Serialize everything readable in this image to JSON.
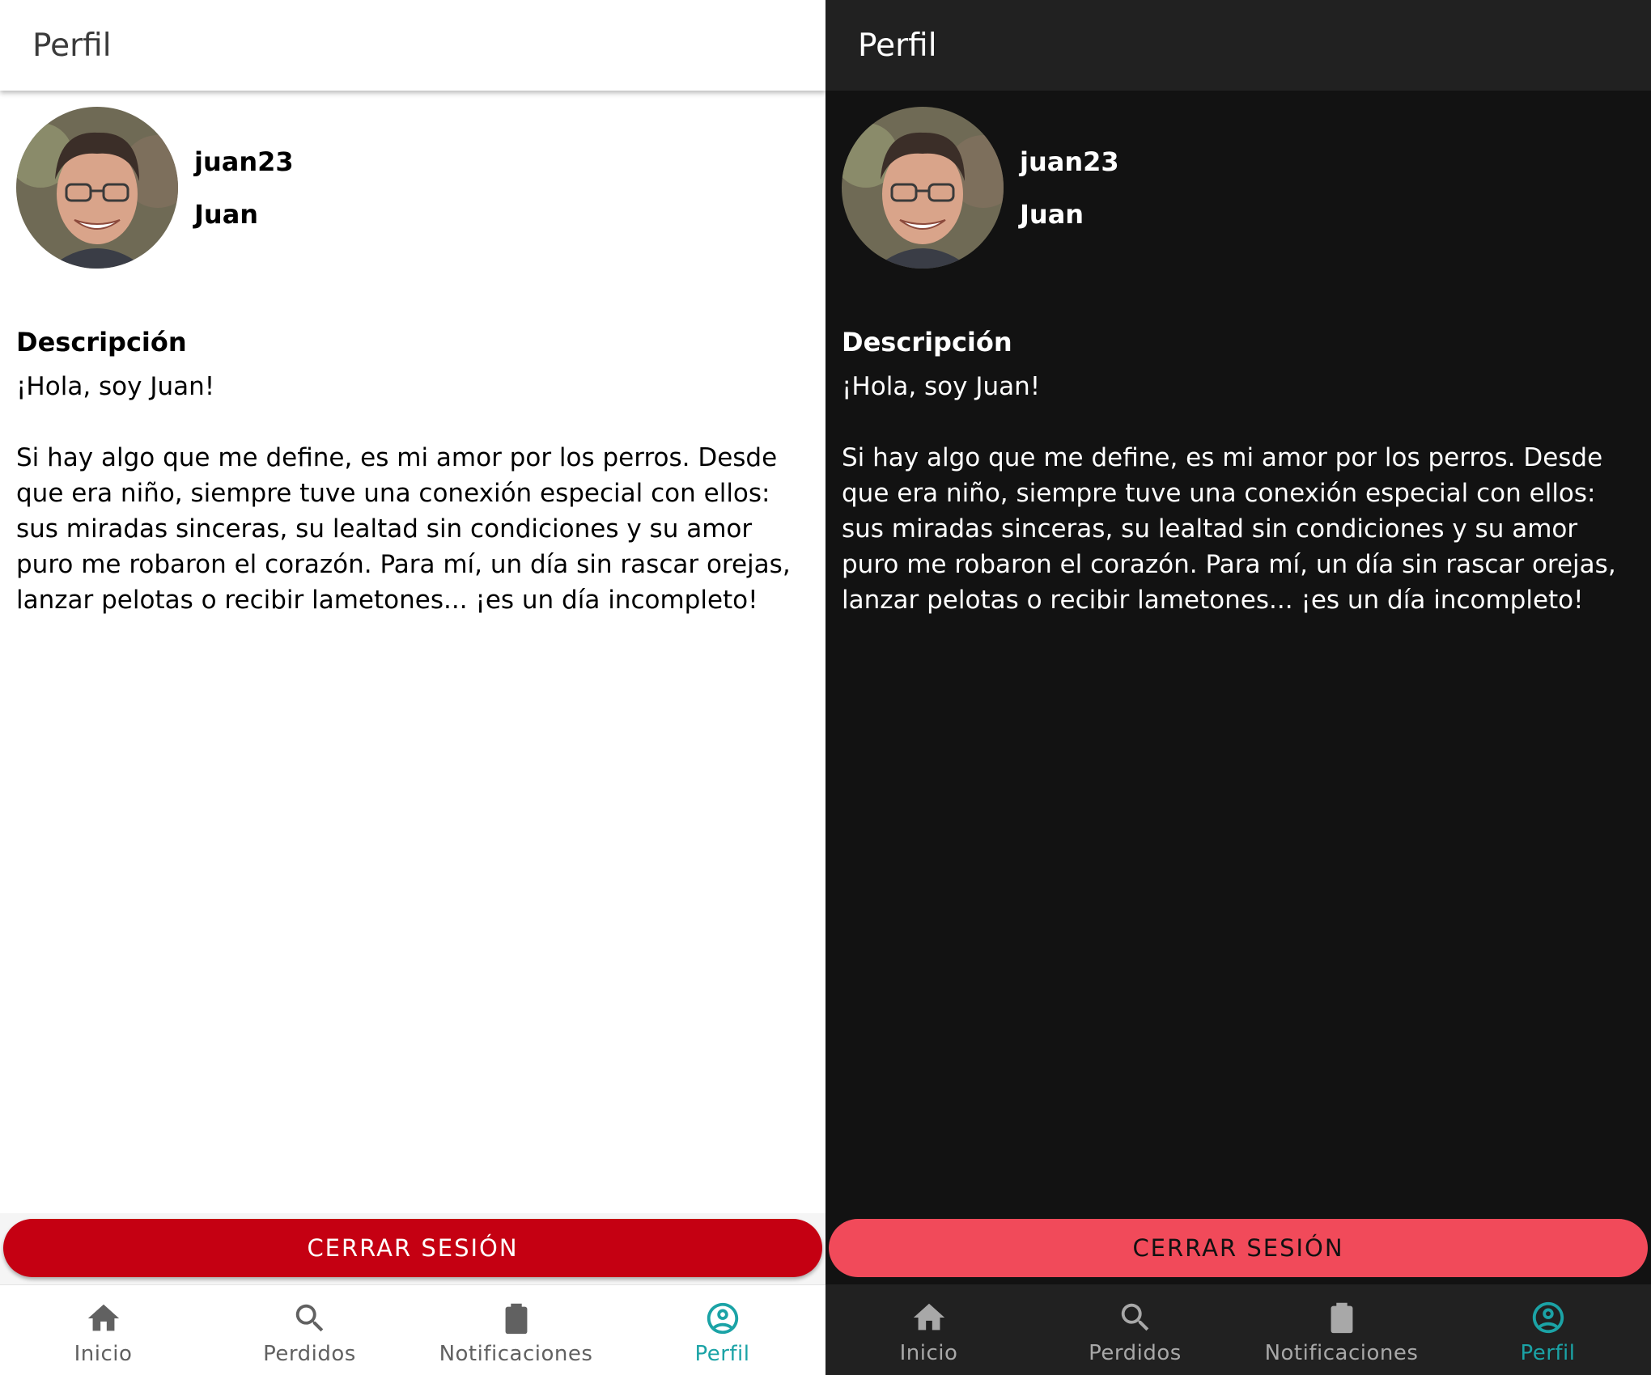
{
  "light": {
    "header": {
      "title": "Perfil"
    },
    "profile": {
      "username": "juan23",
      "name": "Juan"
    },
    "description": {
      "heading": "Descripción",
      "greeting": "¡Hola, soy Juan!",
      "body": "Si hay algo que me define, es mi amor por los perros. Desde que era niño, siempre tuve una conexión especial con ellos: sus miradas sinceras, su lealtad sin condiciones y su amor puro me robaron el corazón. Para mí, un día sin rascar orejas, lanzar pelotas o recibir lametones... ¡es un día incompleto!"
    },
    "logout_label": "CERRAR SESIÓN",
    "nav": [
      {
        "label": "Inicio",
        "icon": "home-icon"
      },
      {
        "label": "Perdidos",
        "icon": "search-icon"
      },
      {
        "label": "Notificaciones",
        "icon": "clipboard-icon"
      },
      {
        "label": "Perfil",
        "icon": "account-circle-icon",
        "active": true
      }
    ]
  },
  "dark": {
    "header": {
      "title": "Perfil"
    },
    "profile": {
      "username": "juan23",
      "name": "Juan"
    },
    "description": {
      "heading": "Descripción",
      "greeting": "¡Hola, soy Juan!",
      "body": "Si hay algo que me define, es mi amor por los perros. Desde que era niño, siempre tuve una conexión especial con ellos: sus miradas sinceras, su lealtad sin condiciones y su amor puro me robaron el corazón. Para mí, un día sin rascar orejas, lanzar pelotas o recibir lametones... ¡es un día incompleto!"
    },
    "logout_label": "CERRAR SESIÓN",
    "nav": [
      {
        "label": "Inicio",
        "icon": "home-icon"
      },
      {
        "label": "Perdidos",
        "icon": "search-icon"
      },
      {
        "label": "Notificaciones",
        "icon": "clipboard-icon"
      },
      {
        "label": "Perfil",
        "icon": "account-circle-icon",
        "active": true
      }
    ]
  },
  "colors": {
    "accent": "#1ba3a6",
    "logout_light": "#c50012",
    "logout_dark": "#f14a5a",
    "dark_background": "#121212",
    "dark_bar": "#212121"
  }
}
